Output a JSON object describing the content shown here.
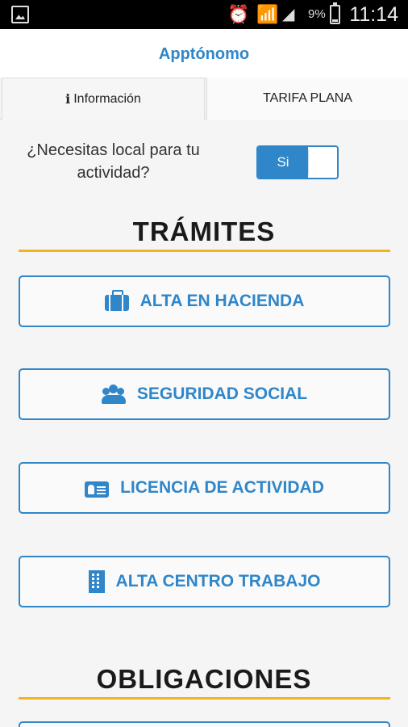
{
  "status_bar": {
    "battery_percent": "9%",
    "time": "11:14",
    "icons": [
      "image-notification-icon",
      "alarm-icon",
      "wifi-icon",
      "signal-icon",
      "battery-icon"
    ]
  },
  "header": {
    "title": "Apptónomo"
  },
  "tabs": [
    {
      "label": "Información",
      "icon": "info-icon",
      "active": true
    },
    {
      "label": "TARIFA PLANA",
      "active": false
    }
  ],
  "question": {
    "text": "¿Necesitas local para tu actividad?",
    "toggle_label": "Si",
    "toggle_on": true
  },
  "sections": {
    "tramites": {
      "title": "TRÁMITES",
      "buttons": [
        {
          "label": "ALTA EN HACIENDA",
          "icon": "briefcase-icon"
        },
        {
          "label": "SEGURIDAD SOCIAL",
          "icon": "users-icon"
        },
        {
          "label": "LICENCIA DE ACTIVIDAD",
          "icon": "id-card-icon"
        },
        {
          "label": "ALTA CENTRO TRABAJO",
          "icon": "building-icon"
        }
      ]
    },
    "obligaciones": {
      "title": "OBLIGACIONES"
    }
  },
  "colors": {
    "accent": "#2f86c9",
    "underline": "#f2b41e",
    "background": "#f5f5f5"
  }
}
